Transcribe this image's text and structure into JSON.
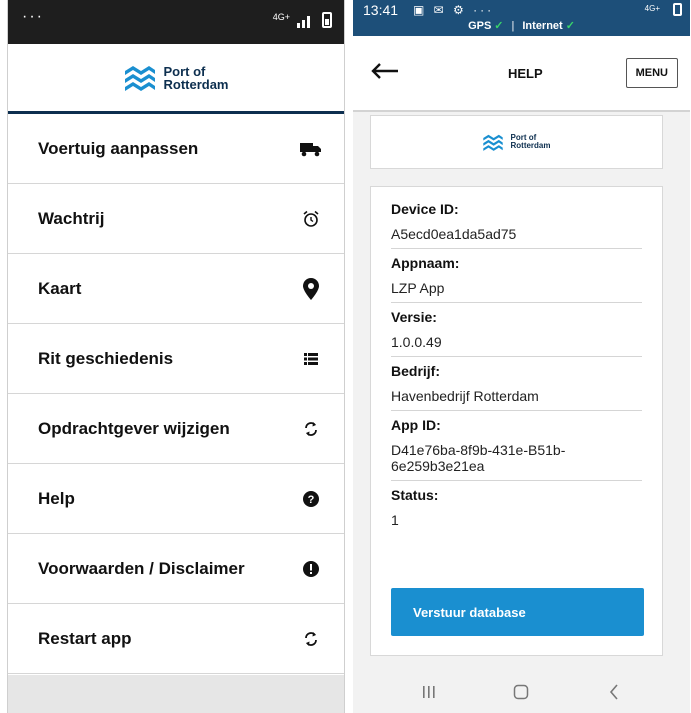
{
  "left_screen": {
    "status": {
      "dots": "···",
      "network": "4G+"
    },
    "logo": {
      "line1": "Port of",
      "line2": "Rotterdam"
    },
    "menu_items": [
      {
        "label": "Voertuig aanpassen",
        "icon": "truck-icon"
      },
      {
        "label": "Wachtrij",
        "icon": "alarm-clock-icon"
      },
      {
        "label": "Kaart",
        "icon": "map-marker-icon"
      },
      {
        "label": "Rit geschiedenis",
        "icon": "list-icon"
      },
      {
        "label": "Opdrachtgever wijzigen",
        "icon": "sync-icon"
      },
      {
        "label": "Help",
        "icon": "question-circle-icon"
      },
      {
        "label": "Voorwaarden / Disclaimer",
        "icon": "exclamation-circle-icon"
      },
      {
        "label": "Restart app",
        "icon": "sync-icon"
      }
    ]
  },
  "right_screen": {
    "status": {
      "time": "13:41",
      "icons": "▣ ✉ ⚙ ···",
      "network": "4G+",
      "gps_label": "GPS",
      "internet_label": "Internet",
      "separator": "|"
    },
    "header": {
      "title": "HELP",
      "menu_label": "MENU"
    },
    "logo": {
      "line1": "Port of",
      "line2": "Rotterdam"
    },
    "fields": [
      {
        "label": "Device ID:",
        "value": "A5ecd0ea1da5ad75"
      },
      {
        "label": "Appnaam:",
        "value": "LZP App"
      },
      {
        "label": "Versie:",
        "value": "1.0.0.49"
      },
      {
        "label": "Bedrijf:",
        "value": "Havenbedrijf Rotterdam"
      },
      {
        "label": "App ID:",
        "value": "D41e76ba-8f9b-431e-B51b-6e259b3e21ea"
      },
      {
        "label": "Status:",
        "value": "1"
      }
    ],
    "send_button": "Verstuur database"
  },
  "colors": {
    "brand_navy": "#0d2f4f",
    "status_blue": "#1d4f79",
    "button_blue": "#1a8fd0",
    "ok_green": "#39d36b"
  }
}
